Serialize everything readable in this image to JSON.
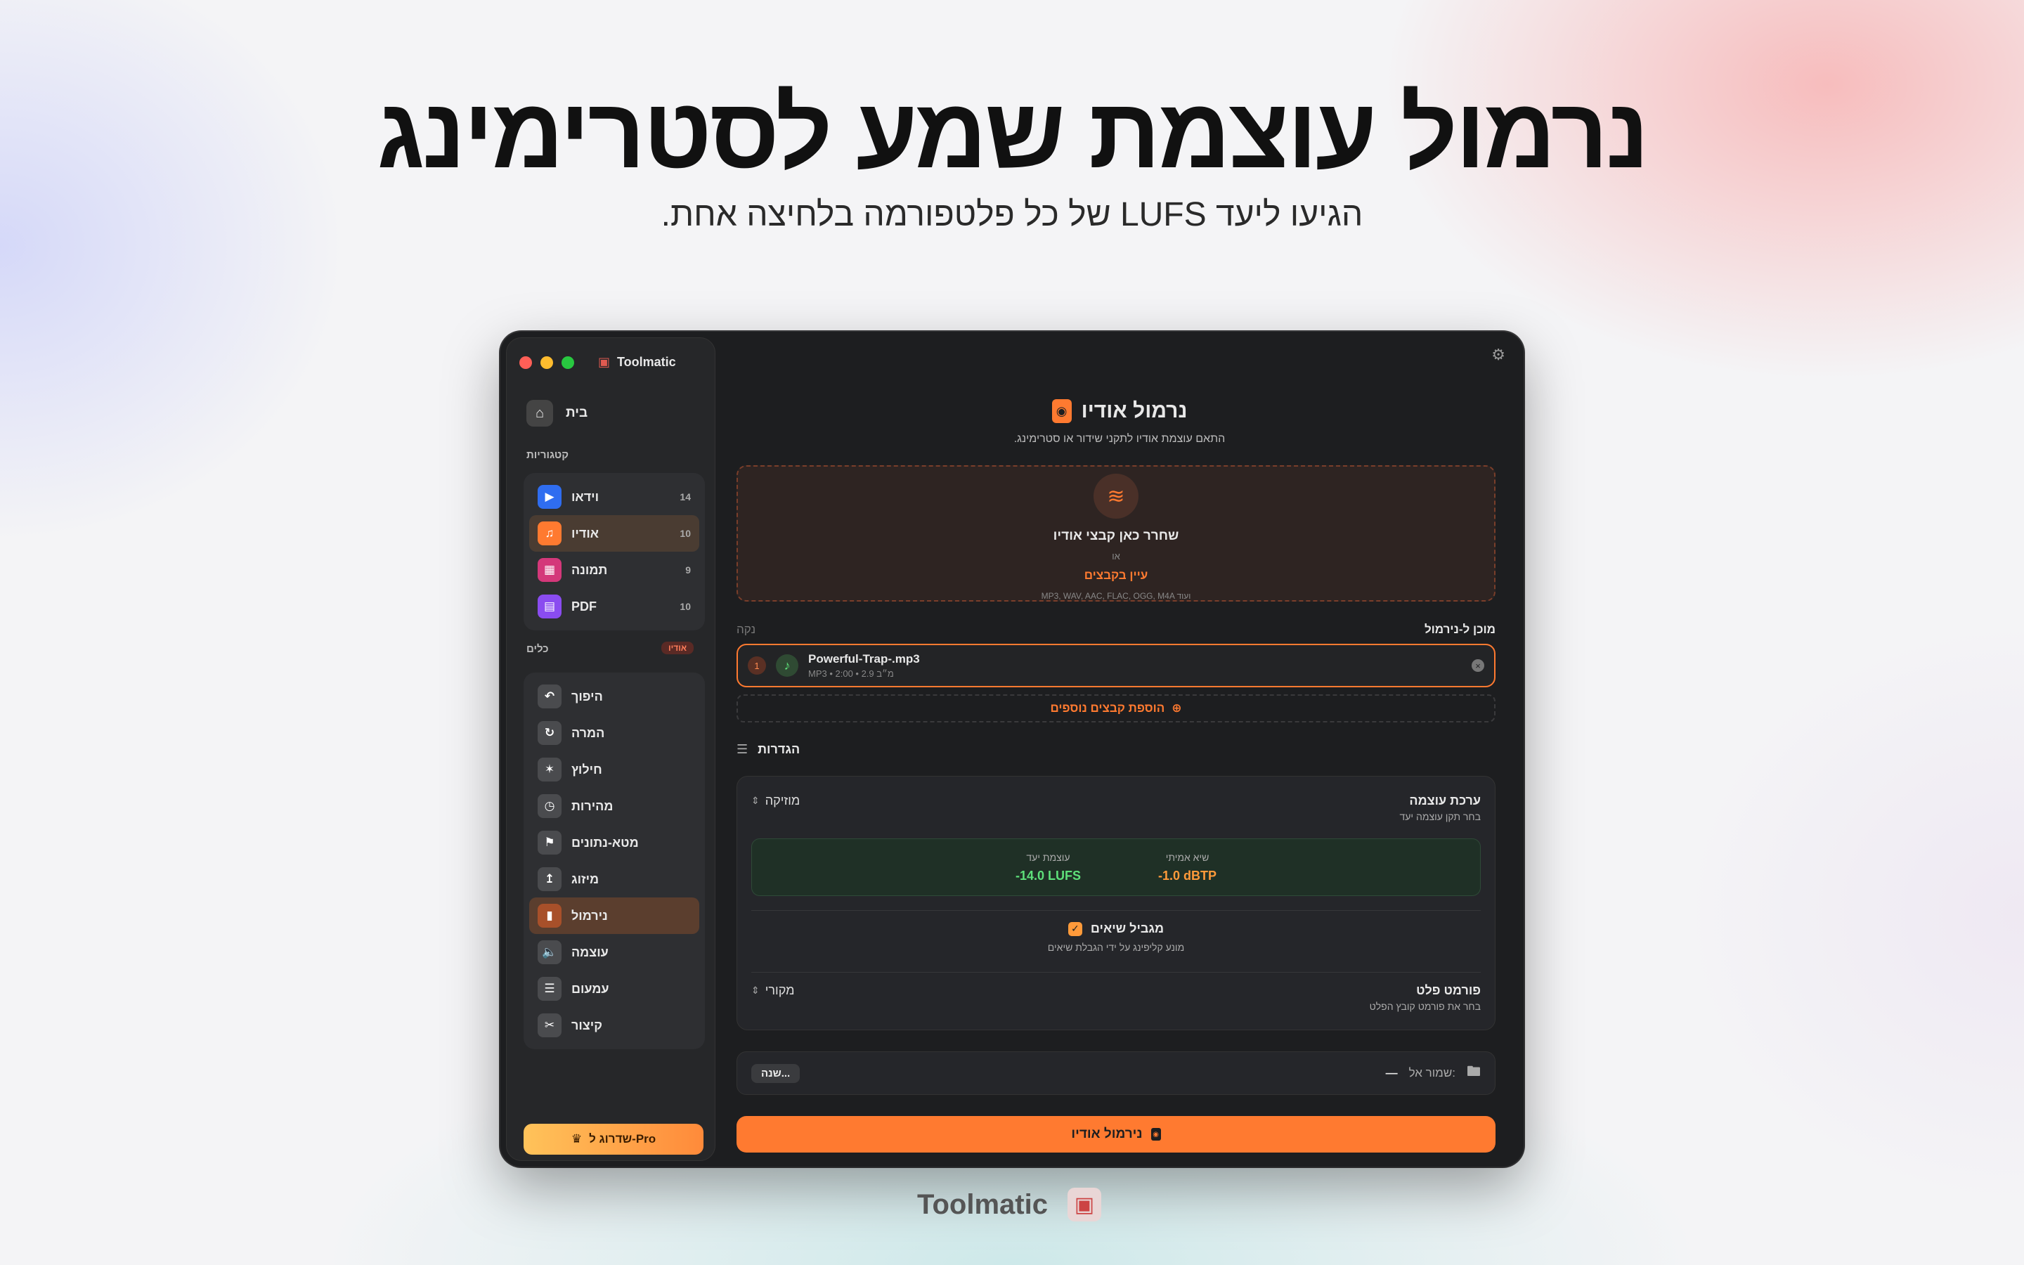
{
  "hero": {
    "headline": "נרמול עוצמת שמע לסטרימינג",
    "subheadline": "הגיעו ליעד LUFS של כל פלטפורמה בלחיצה אחת."
  },
  "window": {
    "app_title": "Toolmatic",
    "home_label": "בית",
    "categories_label": "קטגוריות",
    "categories": [
      {
        "label": "וידאו",
        "count": "14",
        "icon": "video-icon",
        "color": "#2f6df0"
      },
      {
        "label": "אודיו",
        "count": "10",
        "icon": "music-note-icon",
        "color": "#ff7a30"
      },
      {
        "label": "תמונה",
        "count": "9",
        "icon": "image-icon",
        "color": "#d4387a"
      },
      {
        "label": "PDF",
        "count": "10",
        "icon": "pdf-icon",
        "color": "#8a4cf0"
      }
    ],
    "tools_label": "כלים",
    "tools_badge": "אודיו",
    "tools": [
      {
        "label": "היפוך",
        "icon": "reverse-icon"
      },
      {
        "label": "המרה",
        "icon": "convert-icon"
      },
      {
        "label": "חילוץ",
        "icon": "extract-icon"
      },
      {
        "label": "מהירות",
        "icon": "speed-icon"
      },
      {
        "label": "מטא-נתונים",
        "icon": "tag-icon"
      },
      {
        "label": "מיזוג",
        "icon": "merge-icon"
      },
      {
        "label": "נירמול",
        "icon": "normalize-icon"
      },
      {
        "label": "עוצמה",
        "icon": "volume-icon"
      },
      {
        "label": "עמעום",
        "icon": "fade-icon"
      },
      {
        "label": "קיצור",
        "icon": "scissors-icon"
      }
    ],
    "upgrade_label": "שדרוג ל-Pro"
  },
  "main": {
    "title": "נרמול אודיו",
    "subtitle": "התאם עוצמת אודיו לתקני שידור או סטרימינג.",
    "drop": {
      "title": "שחרר כאן קבצי אודיו",
      "or": "או",
      "browse": "עיין בקבצים",
      "formats": "MP3, WAV, AAC, FLAC, OGG, M4A ועוד"
    },
    "list_title": "מוכן ל-נירמול",
    "clear_label": "נקה",
    "file": {
      "index": "1",
      "name": "Powerful-Trap-.mp3",
      "meta": "MP3 • 2:00 • 2.9 מ״ב"
    },
    "add_more": "הוספת קבצים נוספים",
    "settings_title": "הגדרות",
    "preset": {
      "title": "ערכת עוצמה",
      "subtitle": "בחר תקן עוצמה יעד",
      "value": "מוזיקה"
    },
    "targets": {
      "loudness_label": "עוצמת יעד",
      "loudness_value": "-14.0 LUFS",
      "peak_label": "שיא אמיתי",
      "peak_value": "-1.0 dBTP"
    },
    "limiter": {
      "title": "מגביל שיאים",
      "subtitle": "מונע קליפינג על ידי הגבלת שיאים"
    },
    "output_format": {
      "title": "פורמט פלט",
      "subtitle": "בחר את פורמט קובץ הפלט",
      "value": "מקורי"
    },
    "save_to": {
      "change": "שנה...",
      "label": "שמור אל:",
      "value": "—"
    },
    "cta": "נירמול אודיו"
  },
  "footer_brand": "Toolmatic",
  "colors": {
    "accent": "#ff7a30",
    "success": "#5ee07a",
    "window_bg": "#1d1e20"
  }
}
